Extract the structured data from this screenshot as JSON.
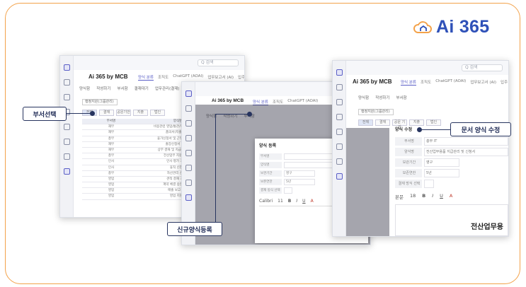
{
  "logo": {
    "text": "Ai 365",
    "icon": "cloud-house-icon",
    "color": "#2f51b8"
  },
  "window1": {
    "title": "Ai 365 by MCB",
    "tabs": [
      "양식 분류",
      "조직도",
      "ChatGPT (AOAI)",
      "업무보고서 (AI)",
      "입주 작동"
    ],
    "search_placeholder": "Q 검색",
    "menu": [
      "양식함",
      "작성하기",
      "부서함",
      "결재대기",
      "업무관리(결재)"
    ],
    "filter": "행정지원(그룹관리)",
    "buttons": [
      "전체",
      "결재",
      "공문기안",
      "지출",
      "법인"
    ],
    "columns": [
      "부서명",
      "양식명"
    ],
    "rows": [
      [
        "재무",
        "비용관련 영업/통관/매출관련 신청서"
      ],
      [
        "재무",
        "품의서(지출) 결재"
      ],
      [
        "총무",
        "휴가신청서 및 근무조정 신청서"
      ],
      [
        "재무",
        "출장신청서 결재문"
      ],
      [
        "재무",
        "상부 결재 및 지급 승인 신청서"
      ],
      [
        "총무",
        "전산업무 지원 요청서"
      ],
      [
        "인사",
        "인사 평가 기안서"
      ],
      [
        "인사",
        "휴직 신청서"
      ],
      [
        "총무",
        "자산관리 신청서"
      ],
      [
        "영업",
        "견적 결재 기안서"
      ],
      [
        "영업",
        "계약 체결 승인 의뢰서"
      ],
      [
        "영업",
        "매출 보고 기안"
      ],
      [
        "영업",
        "영업 지원서"
      ]
    ]
  },
  "window2": {
    "title": "Ai 365 by MCB",
    "tabs": [
      "양식 분류",
      "조직도",
      "ChatGPT (AOAI)"
    ],
    "menu": [
      "양식함",
      "작성하기",
      "부서함"
    ],
    "dialog_title": "양식 등록",
    "fields": [
      {
        "label": "부서명",
        "value": ""
      },
      {
        "label": "양식명",
        "value": ""
      },
      {
        "label": "보관기간",
        "value": "영구"
      },
      {
        "label": "보존연한",
        "value": "5년"
      },
      {
        "label": "결재 방식 선택",
        "value": ""
      }
    ],
    "editor_toolbar": [
      "Calibri",
      "11",
      "B",
      "I",
      "U",
      "A"
    ]
  },
  "window3": {
    "title": "Ai 365 by MCB",
    "tabs": [
      "양식 분류",
      "조직도",
      "ChatGPT (AOAI)",
      "업무보고서 (AI)",
      "입주 작동"
    ],
    "search_placeholder": "Q 검색",
    "menu": [
      "양식함",
      "작성하기",
      "부서함"
    ],
    "filter": "행정지원(그룹관리)",
    "buttons": [
      "전체",
      "결재",
      "공문 기안",
      "지출",
      "법인"
    ],
    "section_title": "양식 수정",
    "fields": [
      {
        "label": "부서명",
        "value": "총무 IT"
      },
      {
        "label": "양식명",
        "value": "전산업무용품 지급관리 및 신청서"
      },
      {
        "label": "보관기간",
        "value": "영구"
      },
      {
        "label": "보존연한",
        "value": "5년"
      },
      {
        "label": "결재 방식 선택",
        "value": ""
      }
    ],
    "editor_toolbar": [
      "본문",
      "18",
      "B",
      "I",
      "U",
      "A"
    ],
    "doc_title": "전산업무용"
  },
  "callouts": {
    "dept_select": "부서선택",
    "new_form": "신규양식등록",
    "edit_form": "문서 양식 수정"
  }
}
